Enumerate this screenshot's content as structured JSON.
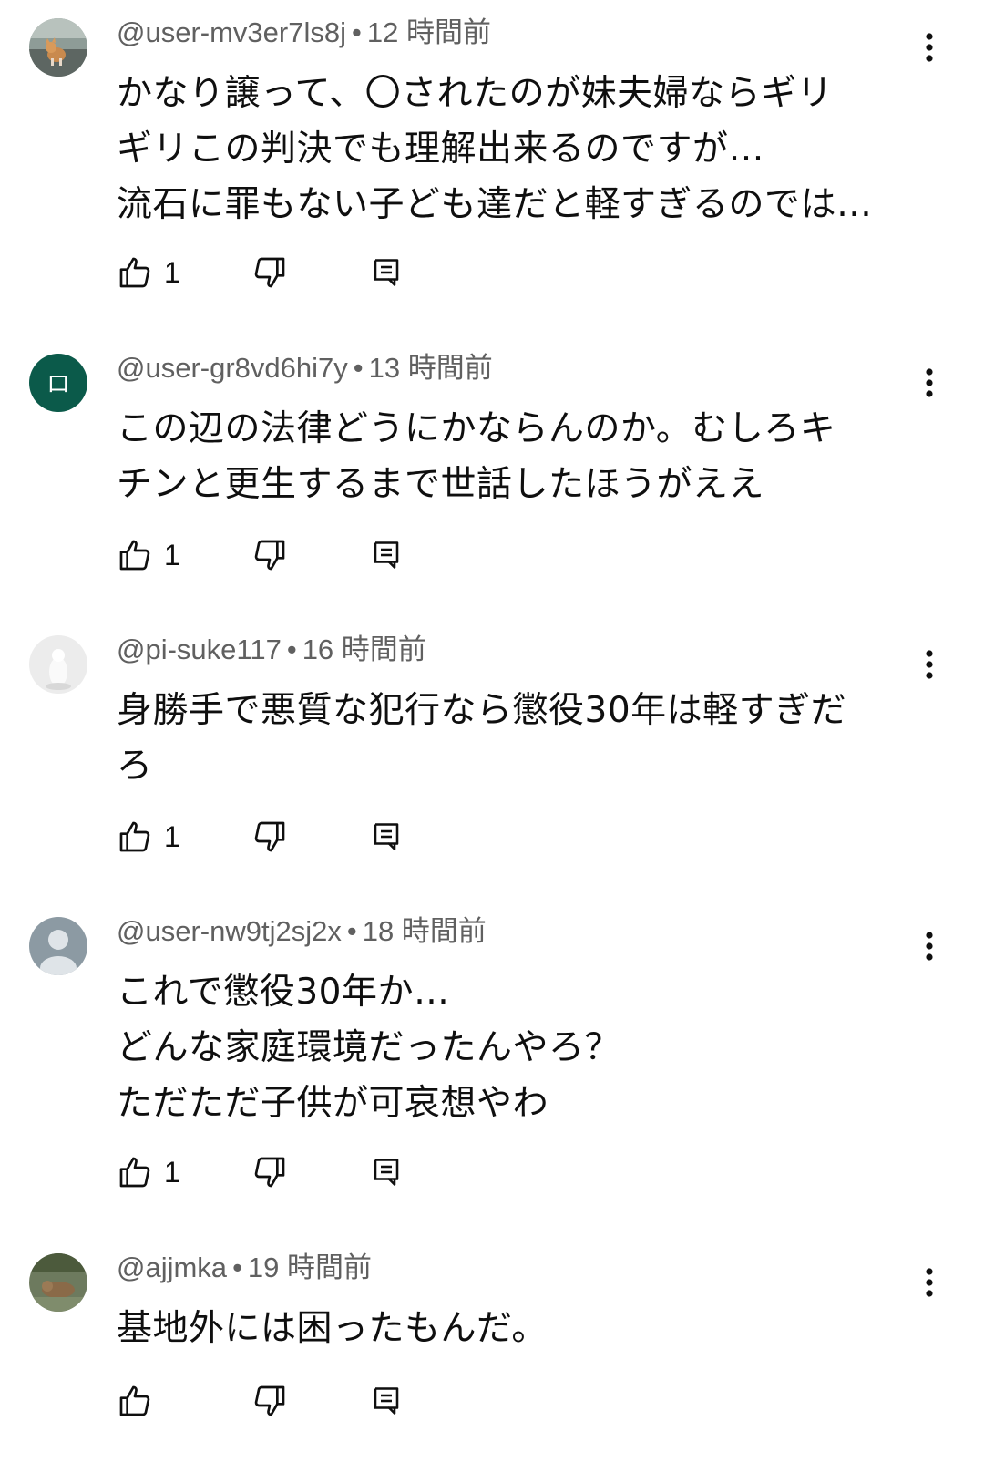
{
  "comments": [
    {
      "handle": "@user-mv3er7ls8j",
      "time": "12 時間前",
      "lines": [
        "かなり譲って、〇されたのが妹夫婦ならギリ",
        "ギリこの判決でも理解出来るのですが…",
        "流石に罪もない子ども達だと軽すぎるのでは…"
      ],
      "likes": "1",
      "avatar": {
        "type": "photo-cat",
        "bg": "#7b8a86"
      }
    },
    {
      "handle": "@user-gr8vd6hi7y",
      "time": "13 時間前",
      "lines": [
        "この辺の法律どうにかならんのか。むしろキ",
        "チンと更生するまで世話したほうがええ"
      ],
      "likes": "1",
      "avatar": {
        "type": "letter",
        "letter": "ロ",
        "bg": "#0b5a4a"
      }
    },
    {
      "handle": "@pi-suke117",
      "time": "16 時間前",
      "lines": [
        "身勝手で悪質な犯行なら懲役30年は軽すぎだ",
        "ろ"
      ],
      "likes": "1",
      "avatar": {
        "type": "photo-white",
        "bg": "#e9e9e9"
      }
    },
    {
      "handle": "@user-nw9tj2sj2x",
      "time": "18 時間前",
      "lines": [
        "これで懲役30年か…",
        "どんな家庭環境だったんやろ？",
        "ただただ子供が可哀想やわ"
      ],
      "likes": "1",
      "avatar": {
        "type": "default",
        "bg": "#8c9aa3"
      }
    },
    {
      "handle": "@ajjmka",
      "time": "19 時間前",
      "lines": [
        "基地外には困ったもんだ。"
      ],
      "likes": "",
      "avatar": {
        "type": "photo-dog",
        "bg": "#5d6b4f"
      }
    }
  ],
  "colors": {
    "text": "#0f0f0f",
    "meta": "#606060",
    "icon": "#0f0f0f"
  },
  "icons": {
    "like": "thumbs-up-icon",
    "dislike": "thumbs-down-icon",
    "reply": "reply-comment-icon",
    "more": "vertical-dots-icon"
  }
}
